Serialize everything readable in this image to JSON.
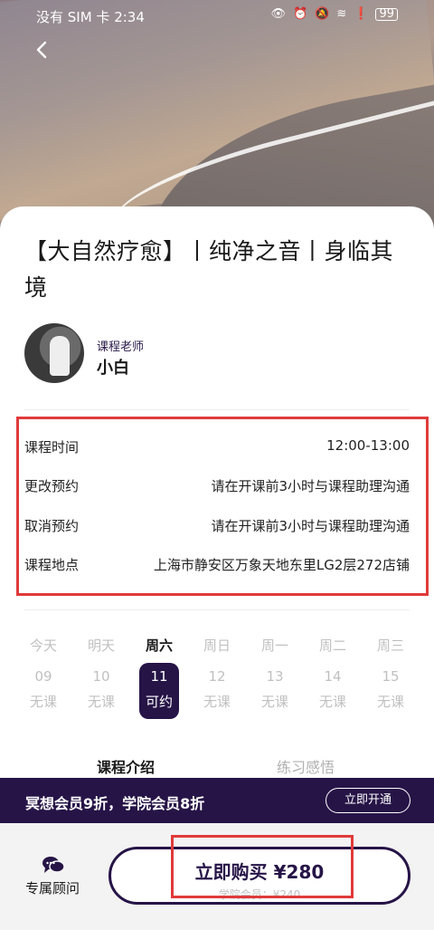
{
  "status": {
    "carrier_time": "没有 SIM 卡 2:34",
    "battery": "99"
  },
  "course": {
    "title": "【大自然疗愈】丨纯净之音丨身临其境"
  },
  "teacher": {
    "role": "课程老师",
    "name": "小白"
  },
  "info": {
    "rows": [
      {
        "label": "课程时间",
        "value": "12:00-13:00"
      },
      {
        "label": "更改预约",
        "value": "请在开课前3小时与课程助理沟通"
      },
      {
        "label": "取消预约",
        "value": "请在开课前3小时与课程助理沟通"
      },
      {
        "label": "课程地点",
        "value": "上海市静安区万象天地东里LG2层272店铺"
      }
    ]
  },
  "schedule": {
    "days": [
      {
        "weekday": "今天",
        "date": "09",
        "status": "无课",
        "active": false
      },
      {
        "weekday": "明天",
        "date": "10",
        "status": "无课",
        "active": false
      },
      {
        "weekday": "周六",
        "date": "11",
        "status": "可约",
        "active": true
      },
      {
        "weekday": "周日",
        "date": "12",
        "status": "无课",
        "active": false
      },
      {
        "weekday": "周一",
        "date": "13",
        "status": "无课",
        "active": false
      },
      {
        "weekday": "周二",
        "date": "14",
        "status": "无课",
        "active": false
      },
      {
        "weekday": "周三",
        "date": "15",
        "status": "无课",
        "active": false
      }
    ]
  },
  "tabs": {
    "intro": "课程介绍",
    "reflection": "练习感悟"
  },
  "promo": {
    "text": "冥想会员9折，学院会员8折",
    "button": "立即开通"
  },
  "footer": {
    "advisor_label": "专属顾问",
    "buy_label": "立即购买 ¥280",
    "member_price": "学院会员：¥240"
  },
  "colors": {
    "brand": "#261447",
    "highlight": "#e03a3a"
  }
}
